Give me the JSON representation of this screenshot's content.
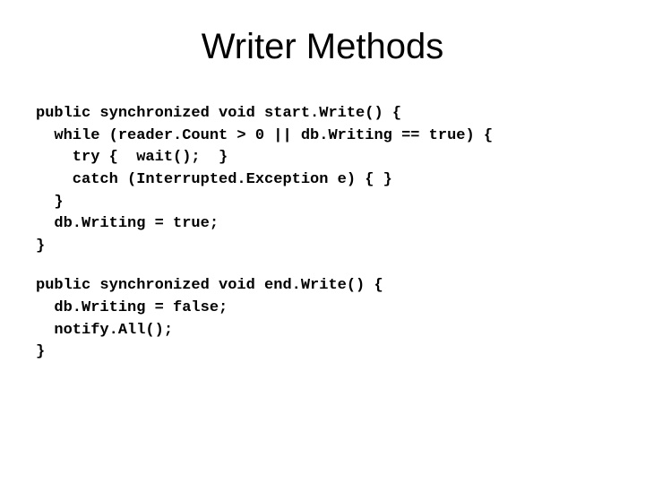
{
  "title": "Writer Methods",
  "code": {
    "block1_l1": "public synchronized void start.Write() {",
    "block1_l2": "  while (reader.Count > 0 || db.Writing == true) {",
    "block1_l3": "    try {  wait();  }",
    "block1_l4": "    catch (Interrupted.Exception e) { }",
    "block1_l5": "  }",
    "block1_l6": "  db.Writing = true;",
    "block1_l7": "}",
    "block2_l1": "public synchronized void end.Write() {",
    "block2_l2": "  db.Writing = false;",
    "block2_l3": "  notify.All();",
    "block2_l4": "}"
  }
}
